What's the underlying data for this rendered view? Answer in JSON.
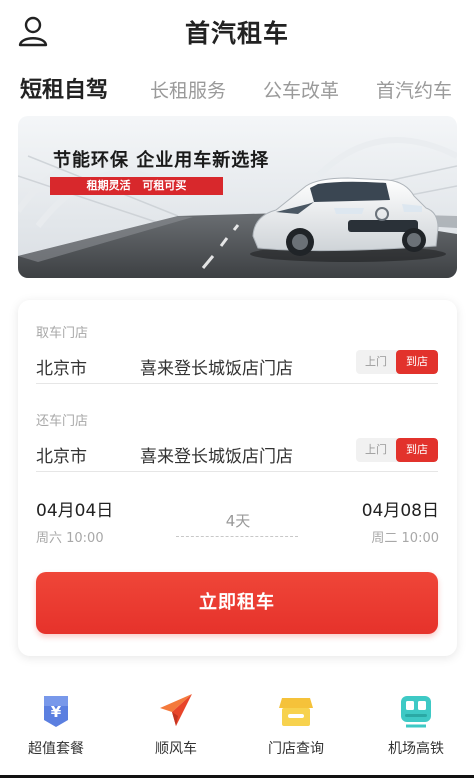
{
  "header": {
    "title": "首汽租车"
  },
  "tabs": [
    {
      "label": "短租自驾",
      "active": true
    },
    {
      "label": "长租服务",
      "active": false
    },
    {
      "label": "公车改革",
      "active": false
    },
    {
      "label": "首汽约车",
      "active": false
    }
  ],
  "banner": {
    "headline": "节能环保  企业用车新选择",
    "tagline": "租期灵活  可租可买"
  },
  "booking": {
    "pickup": {
      "label": "取车门店",
      "city": "北京市",
      "store": "喜来登长城饭店门店",
      "mode_off": "上门",
      "mode_on": "到店"
    },
    "return": {
      "label": "还车门店",
      "city": "北京市",
      "store": "喜来登长城饭店门店",
      "mode_off": "上门",
      "mode_on": "到店"
    },
    "start": {
      "date": "04月04日",
      "time": "周六 10:00"
    },
    "end": {
      "date": "04月08日",
      "time": "周二 10:00"
    },
    "duration": "4天",
    "cta": "立即租车"
  },
  "quick_nav": [
    {
      "label": "超值套餐",
      "icon": "value-package-icon",
      "color": "#5b7fe0"
    },
    {
      "label": "顺风车",
      "icon": "paper-plane-icon",
      "color": "#f0552e"
    },
    {
      "label": "门店查询",
      "icon": "store-icon",
      "color": "#f5c23a"
    },
    {
      "label": "机场高铁",
      "icon": "train-icon",
      "color": "#3ec9c5"
    }
  ],
  "colors": {
    "accent": "#e6322b",
    "muted": "#9a9a9a"
  }
}
